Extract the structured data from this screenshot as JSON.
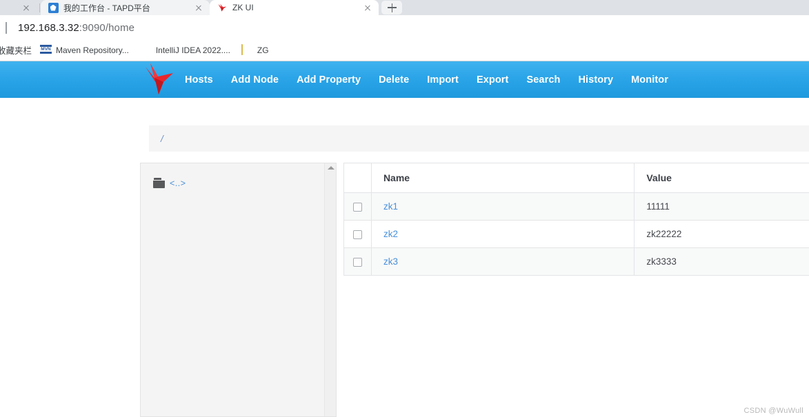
{
  "browser": {
    "tabs": [
      {
        "title": "",
        "favicon": "none",
        "state": "clipped-previous",
        "has_close": true
      },
      {
        "title": "我的工作台 - TAPD平台",
        "favicon": "tapd-icon",
        "state": "inactive",
        "has_close": true
      },
      {
        "title": "ZK UI",
        "favicon": "zk-bird-icon",
        "state": "active",
        "has_close": true
      }
    ],
    "new_tab_label": "+",
    "omnibox": {
      "url_host": "192.168.3.32",
      "url_rest": ":9090/home",
      "url_full": "192.168.3.32:9090/home"
    },
    "bookmarks_bar": {
      "label": "收藏夹栏",
      "items": [
        {
          "icon": "maven-icon",
          "icon_text": "MVN",
          "label": "Maven Repository..."
        },
        {
          "icon": "intellij-icon",
          "label": "IntelliJ IDEA 2022...."
        },
        {
          "icon": "folder-icon",
          "label": "ZG"
        }
      ]
    }
  },
  "app": {
    "brand": {
      "logo": "zk-bird-logo",
      "accent_color": "#2ba4e8",
      "logo_color": "#e8262c"
    },
    "nav": {
      "items": [
        {
          "label": "Hosts"
        },
        {
          "label": "Add Node"
        },
        {
          "label": "Add Property"
        },
        {
          "label": "Delete"
        },
        {
          "label": "Import"
        },
        {
          "label": "Export"
        },
        {
          "label": "Search"
        },
        {
          "label": "History"
        },
        {
          "label": "Monitor"
        }
      ]
    },
    "breadcrumb": {
      "root_label": "/"
    },
    "tree": {
      "nodes": [
        {
          "icon": "folder-icon",
          "label": "<..>"
        }
      ],
      "scrollbar": {
        "up_arrow": "▲"
      }
    },
    "table": {
      "columns": [
        "",
        "Name",
        "Value"
      ],
      "rows": [
        {
          "selected": false,
          "name": "zk1",
          "value": "11111"
        },
        {
          "selected": false,
          "name": "zk2",
          "value": "zk22222"
        },
        {
          "selected": false,
          "name": "zk3",
          "value": "zk3333"
        }
      ]
    }
  },
  "watermark": "CSDN @WuWull"
}
